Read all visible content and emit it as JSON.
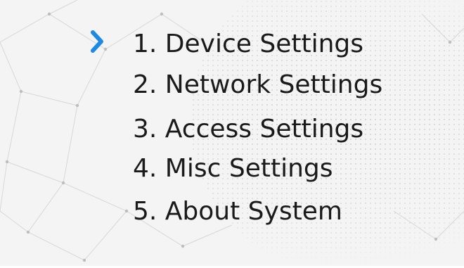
{
  "menu": {
    "selected_index": 0,
    "items": [
      {
        "label": "1. Device Settings"
      },
      {
        "label": "2. Network Settings"
      },
      {
        "label": "3. Access Settings"
      },
      {
        "label": "4. Misc Settings"
      },
      {
        "label": "5. About System"
      }
    ]
  },
  "colors": {
    "background": "#f3f3f3",
    "text": "#1a1a1a",
    "cursor": "#1e88e5"
  },
  "icons": {
    "cursor": "chevron-right-icon"
  }
}
